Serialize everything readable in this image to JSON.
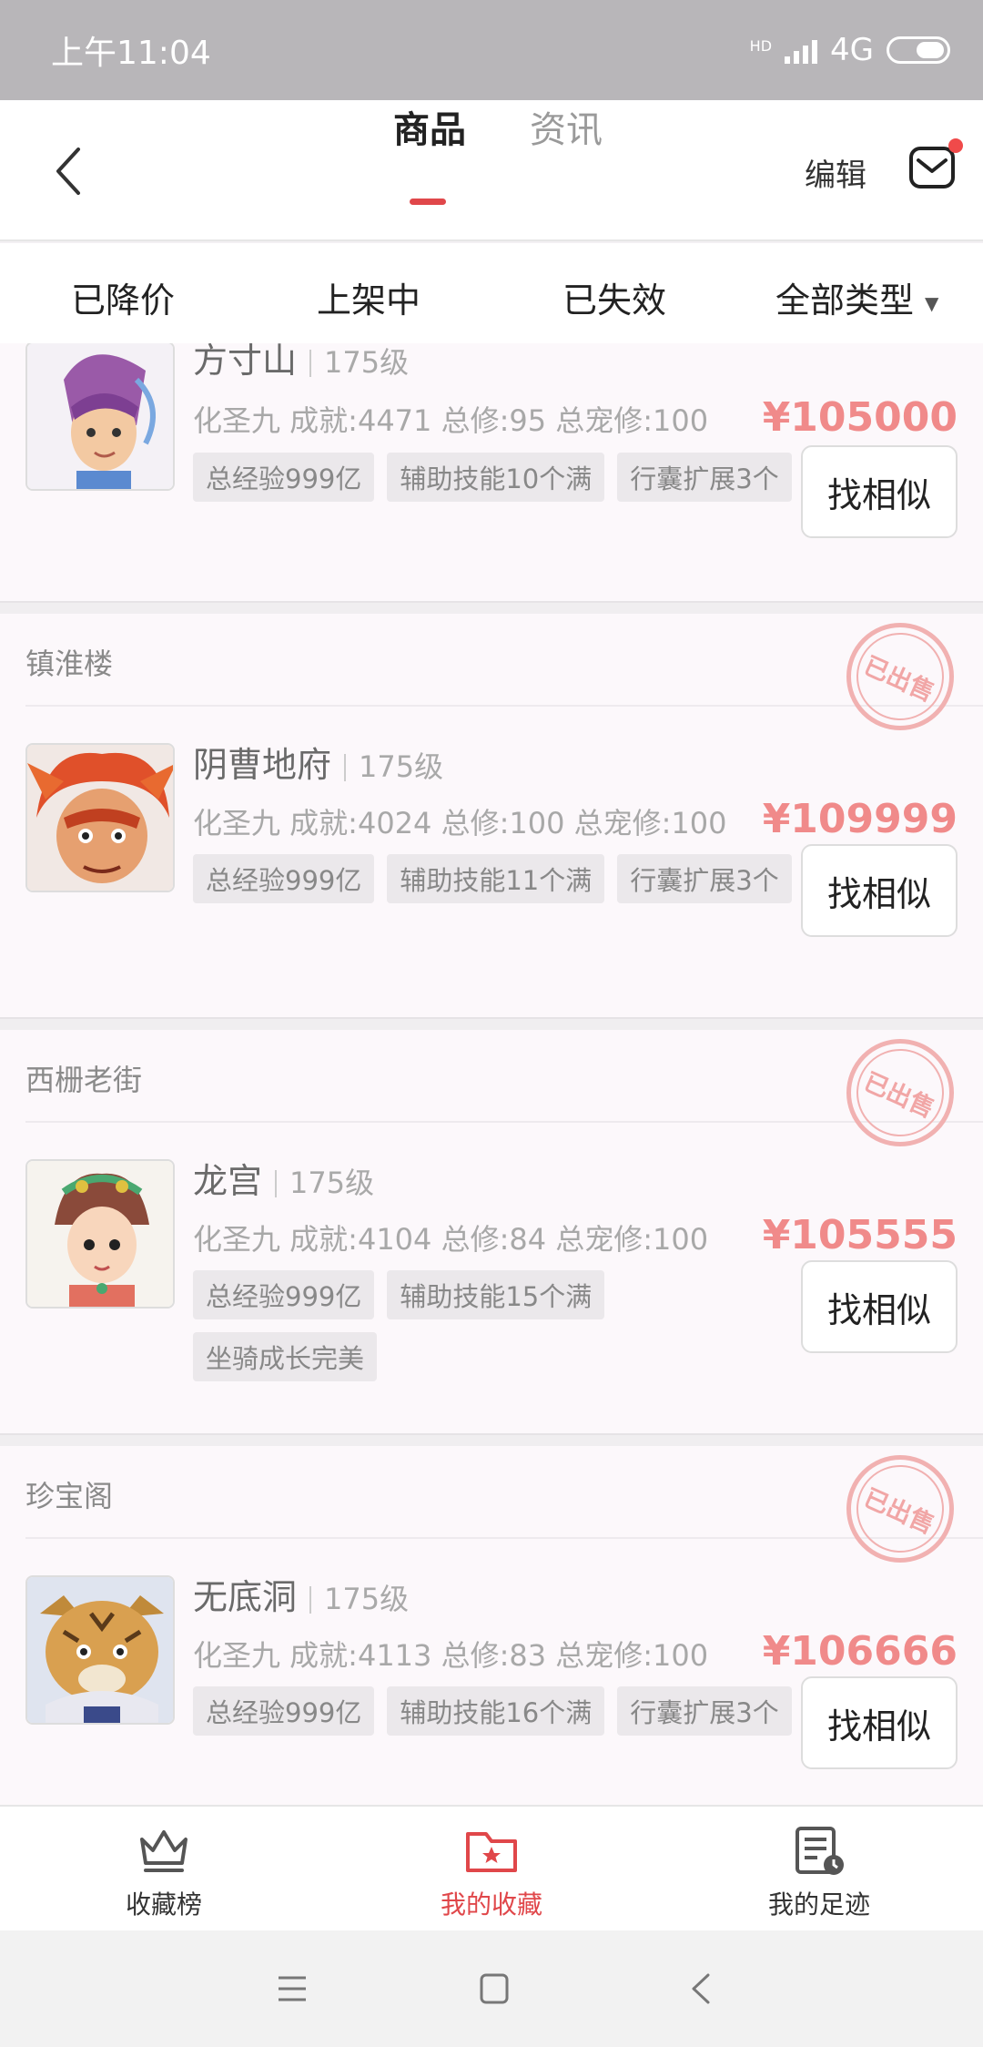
{
  "status_bar": {
    "time": "上午11:04",
    "network": "4G",
    "hd": "HD"
  },
  "header": {
    "tabs": [
      {
        "label": "商品",
        "active": true
      },
      {
        "label": "资讯",
        "active": false
      }
    ],
    "edit_label": "编辑",
    "icons": {
      "back": "chevron-left-icon",
      "mail": "mail-icon"
    },
    "accent_color": "#e0474a"
  },
  "filters": [
    {
      "label": "已降价"
    },
    {
      "label": "上架中"
    },
    {
      "label": "已失效"
    },
    {
      "label": "全部类型",
      "dropdown": true
    }
  ],
  "listings": [
    {
      "seller": "",
      "server": "方寸山",
      "level": "175级",
      "stats": "化圣九 成就:4471 总修:95 总宠修:100",
      "price": "¥105000",
      "tags": [
        "总经验999亿",
        "辅助技能10个满",
        "行囊扩展3个"
      ],
      "similar_label": "找相似",
      "sold": false
    },
    {
      "seller": "镇淮楼",
      "server": "阴曹地府",
      "level": "175级",
      "stats": "化圣九 成就:4024 总修:100 总宠修:100",
      "price": "¥109999",
      "tags": [
        "总经验999亿",
        "辅助技能11个满",
        "行囊扩展3个"
      ],
      "similar_label": "找相似",
      "sold": true,
      "stamp": "已出售"
    },
    {
      "seller": "西栅老街",
      "server": "龙宫",
      "level": "175级",
      "stats": "化圣九 成就:4104 总修:84 总宠修:100",
      "price": "¥105555",
      "tags": [
        "总经验999亿",
        "辅助技能15个满",
        "坐骑成长完美"
      ],
      "similar_label": "找相似",
      "sold": true,
      "stamp": "已出售"
    },
    {
      "seller": "珍宝阁",
      "server": "无底洞",
      "level": "175级",
      "stats": "化圣九 成就:4113 总修:83 总宠修:100",
      "price": "¥106666",
      "tags": [
        "总经验999亿",
        "辅助技能16个满",
        "行囊扩展3个"
      ],
      "similar_label": "找相似",
      "sold": true,
      "stamp": "已出售"
    }
  ],
  "bottom_nav": [
    {
      "label": "收藏榜",
      "icon": "crown-icon",
      "active": false
    },
    {
      "label": "我的收藏",
      "icon": "star-folder-icon",
      "active": true
    },
    {
      "label": "我的足迹",
      "icon": "history-icon",
      "active": false
    }
  ],
  "system_nav": [
    "menu-icon",
    "home-icon",
    "back-icon"
  ]
}
